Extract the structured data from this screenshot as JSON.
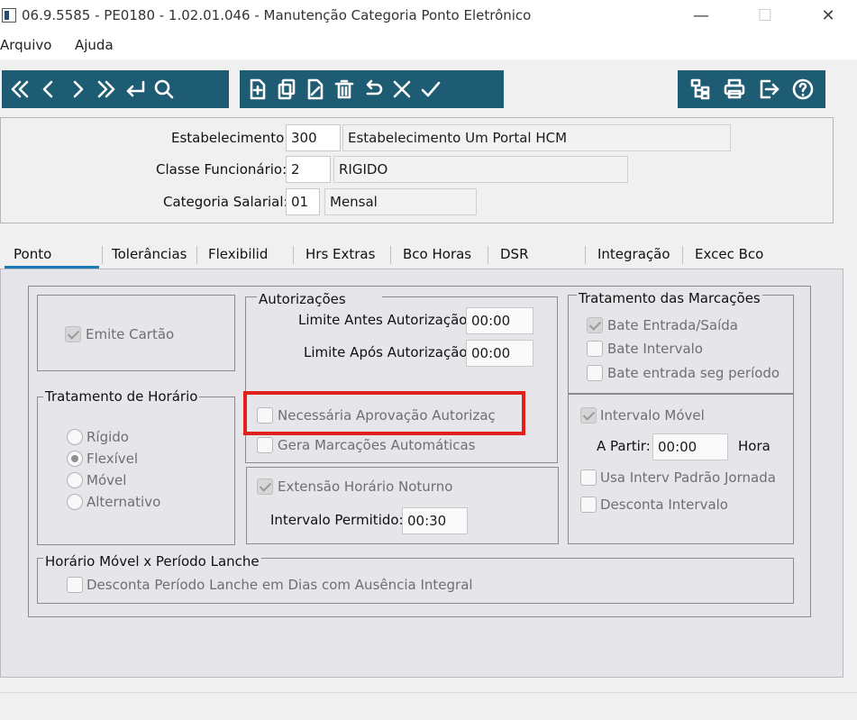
{
  "window": {
    "title": "06.9.5585 - PE0180 - 1.02.01.046 - Manutenção Categoria Ponto Eletrônico",
    "minimize": "—",
    "maximize": "☐",
    "close": "✕"
  },
  "menu": {
    "items": [
      "Arquivo",
      "Ajuda"
    ]
  },
  "toolbar": {
    "nav_icons": [
      "first-record-icon",
      "previous-record-icon",
      "next-record-icon",
      "last-record-icon",
      "goto-record-icon",
      "search-icon"
    ],
    "edit_icons": [
      "new-record-icon",
      "copy-record-icon",
      "edit-record-icon",
      "delete-record-icon",
      "undo-icon",
      "cancel-icon",
      "save-icon"
    ],
    "util_icons": [
      "navigation-tree-icon",
      "print-icon",
      "exit-icon",
      "help-icon"
    ],
    "color": "#1d5c73"
  },
  "header": {
    "estabelecimento_label": "Estabelecimento:",
    "estabelecimento_code": "300",
    "estabelecimento_name": "Estabelecimento Um Portal HCM",
    "classe_label": "Classe Funcionário:",
    "classe_code": "2",
    "classe_name": "RIGIDO",
    "categoria_label": "Categoria Salarial:",
    "categoria_code": "01",
    "categoria_name": "Mensal"
  },
  "tabs": [
    "Ponto",
    "Tolerâncias",
    "Flexibilid",
    "Hrs Extras",
    "Bco Horas",
    "DSR",
    "Integração",
    "Excec Bco"
  ],
  "active_tab": "Ponto",
  "ponto": {
    "emite_cartao": {
      "label": "Emite Cartão",
      "checked": true
    },
    "tratamento_horario": {
      "title": "Tratamento de Horário",
      "options": [
        "Rígido",
        "Flexível",
        "Móvel",
        "Alternativo"
      ],
      "selected": "Flexível"
    },
    "autorizacoes": {
      "title": "Autorizações",
      "limite_antes_label": "Limite Antes Autorização:",
      "limite_antes_value": "00:00",
      "limite_apos_label": "Limite Após Autorização:",
      "limite_apos_value": "00:00",
      "necessaria_aprovacao": {
        "label": "Necessária Aprovação Autorizaç",
        "checked": false
      },
      "gera_marcacoes": {
        "label": "Gera Marcações Automáticas",
        "checked": false
      }
    },
    "extensao": {
      "label": "Extensão Horário Noturno",
      "checked": true,
      "intervalo_label": "Intervalo Permitido:",
      "intervalo_value": "00:30"
    },
    "tratamento_marcacoes": {
      "title": "Tratamento das Marcações",
      "bate_entrada_saida": {
        "label": "Bate Entrada/Saída",
        "checked": true
      },
      "bate_intervalo": {
        "label": "Bate Intervalo",
        "checked": false
      },
      "bate_entrada_seg": {
        "label": "Bate entrada seg período",
        "checked": false
      }
    },
    "intervalo_movel": {
      "label": "Intervalo Móvel",
      "checked": true,
      "a_partir_label": "A Partir:",
      "a_partir_value": "00:00",
      "hora_label": "Hora",
      "usa_interv": {
        "label": "Usa Interv Padrão Jornada",
        "checked": false
      },
      "desconta_intervalo": {
        "label": "Desconta Intervalo",
        "checked": false
      }
    },
    "horario_movel": {
      "title": "Horário Móvel x Período Lanche",
      "desconta_periodo": {
        "label": "Desconta Período Lanche em Dias com Ausência Integral",
        "checked": false
      }
    }
  },
  "highlight_color": "#e0201b"
}
